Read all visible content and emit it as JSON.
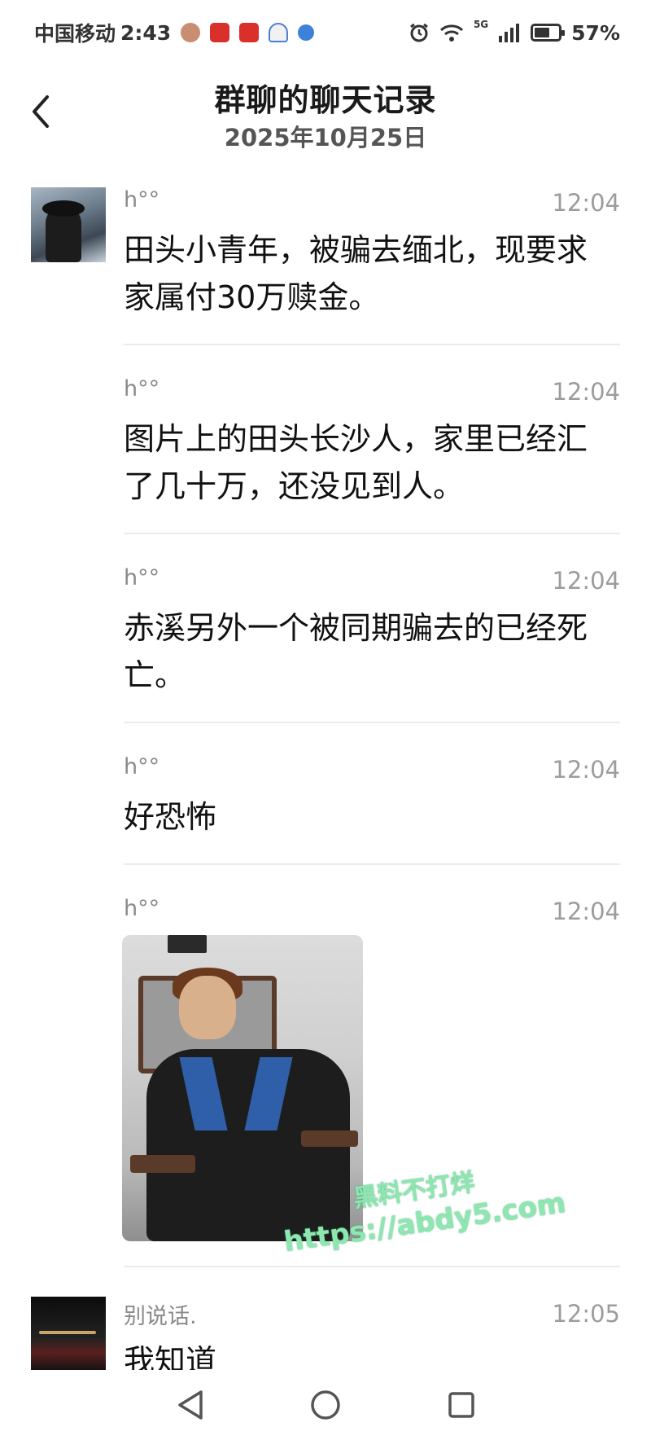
{
  "status_bar": {
    "carrier": "中国移动",
    "time": "2:43",
    "network": "5G",
    "battery": "57%"
  },
  "header": {
    "title": "群聊的聊天记录",
    "subtitle": "2025年10月25日"
  },
  "messages": [
    {
      "sender": "h°°",
      "time": "12:04",
      "text": "田头小青年，被骗去缅北，现要求家属付30万赎金。"
    },
    {
      "sender": "h°°",
      "time": "12:04",
      "text": "图片上的田头长沙人，家里已经汇了几十万，还没见到人。"
    },
    {
      "sender": "h°°",
      "time": "12:04",
      "text": "赤溪另外一个被同期骗去的已经死亡。"
    },
    {
      "sender": "h°°",
      "time": "12:04",
      "text": "好恐怖"
    },
    {
      "sender": "h°°",
      "time": "12:04",
      "image": "photo-person-in-restraint-chair"
    },
    {
      "sender": "别说话.",
      "time": "12:05",
      "text": "我知道"
    }
  ],
  "watermark": {
    "line1": "黑料不打烊",
    "line2": "https://abdy5.com"
  },
  "nav": {
    "back_icon": "triangle-back-icon",
    "home_icon": "circle-home-icon",
    "recents_icon": "square-recents-icon"
  }
}
